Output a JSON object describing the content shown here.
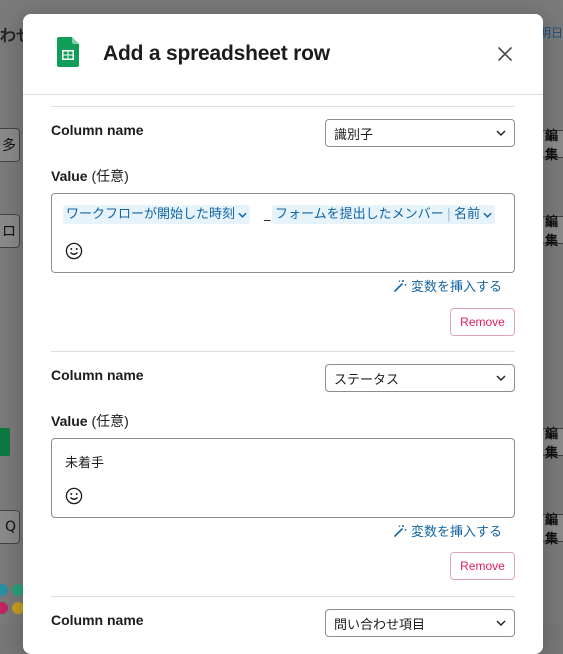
{
  "background": {
    "top_left_text": "わせ",
    "top_right_text": "明日",
    "edit_label": "編集",
    "left_box_1": "多",
    "left_box_2": "ロ",
    "left_box_3": "Q"
  },
  "modal": {
    "title": "Add a spreadsheet row",
    "close_icon": "close-icon",
    "sheet_icon": "google-sheets-icon"
  },
  "rows": [
    {
      "column_label": "Column name",
      "column_value": "識別子",
      "value_label": "Value",
      "value_optional": "(任意)",
      "chips": [
        "ワークフローが開始した時刻",
        "フォームを提出したメンバー",
        "名前"
      ],
      "separator": "_",
      "insert_variable": "変数を挿入する",
      "remove_label": "Remove"
    },
    {
      "column_label": "Column name",
      "column_value": "ステータス",
      "value_label": "Value",
      "value_optional": "(任意)",
      "text_value": "未着手",
      "insert_variable": "変数を挿入する",
      "remove_label": "Remove"
    },
    {
      "column_label": "Column name",
      "column_value": "問い合わせ項目"
    }
  ],
  "colors": {
    "link": "#1264a3",
    "chip_bg": "#e6f3fb",
    "remove": "#e01e5a",
    "sheets_green": "#0f9d58"
  }
}
